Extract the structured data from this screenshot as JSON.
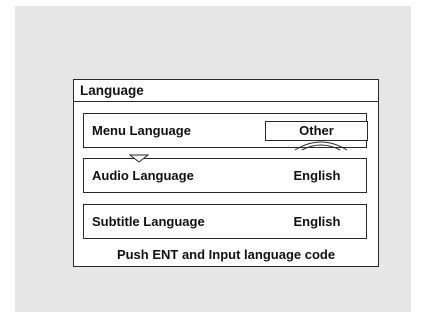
{
  "dialog": {
    "title": "Language",
    "rows": [
      {
        "label": "Menu Language",
        "value": "Other"
      },
      {
        "label": "Audio Language",
        "value": "English"
      },
      {
        "label": "Subtitle Language",
        "value": "English"
      }
    ],
    "footer": "Push ENT and Input language code"
  },
  "icons": [
    "down-arrow-icon",
    "dial-icon"
  ],
  "colors": {
    "background": "#e6e6e7",
    "panel": "#ffffff",
    "border": "#2a2a2a",
    "text": "#111111"
  }
}
